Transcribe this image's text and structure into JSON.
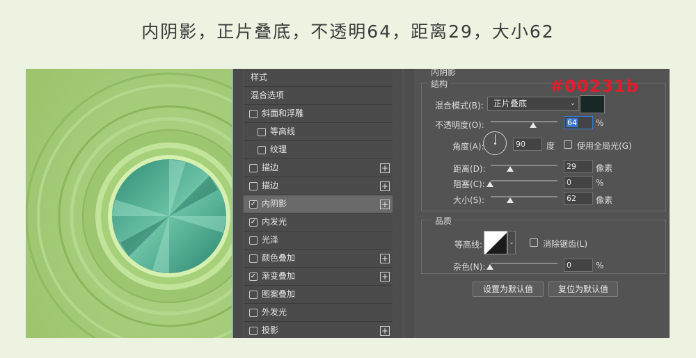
{
  "header": {
    "title": "内阴影，正片叠底，不透明64，距离29，大小62"
  },
  "annotation": {
    "hex_color": "#00231b",
    "color": "#e01e2a"
  },
  "style_list": {
    "items": [
      {
        "label": "样式",
        "checkbox": false,
        "checked": false,
        "plus": false,
        "active": false,
        "indent": 0
      },
      {
        "label": "混合选项",
        "checkbox": false,
        "checked": false,
        "plus": false,
        "active": false,
        "indent": 0
      },
      {
        "label": "斜面和浮雕",
        "checkbox": true,
        "checked": false,
        "plus": false,
        "active": false,
        "indent": 0
      },
      {
        "label": "等高线",
        "checkbox": true,
        "checked": false,
        "plus": false,
        "active": false,
        "indent": 1
      },
      {
        "label": "纹理",
        "checkbox": true,
        "checked": false,
        "plus": false,
        "active": false,
        "indent": 1
      },
      {
        "label": "描边",
        "checkbox": true,
        "checked": false,
        "plus": true,
        "active": false,
        "indent": 0
      },
      {
        "label": "描边",
        "checkbox": true,
        "checked": false,
        "plus": true,
        "active": false,
        "indent": 0
      },
      {
        "label": "内阴影",
        "checkbox": true,
        "checked": true,
        "plus": true,
        "active": true,
        "indent": 0
      },
      {
        "label": "内发光",
        "checkbox": true,
        "checked": true,
        "plus": false,
        "active": false,
        "indent": 0
      },
      {
        "label": "光泽",
        "checkbox": true,
        "checked": false,
        "plus": false,
        "active": false,
        "indent": 0
      },
      {
        "label": "颜色叠加",
        "checkbox": true,
        "checked": false,
        "plus": true,
        "active": false,
        "indent": 0
      },
      {
        "label": "渐变叠加",
        "checkbox": true,
        "checked": true,
        "plus": true,
        "active": false,
        "indent": 0
      },
      {
        "label": "图案叠加",
        "checkbox": true,
        "checked": false,
        "plus": false,
        "active": false,
        "indent": 0
      },
      {
        "label": "外发光",
        "checkbox": true,
        "checked": false,
        "plus": false,
        "active": false,
        "indent": 0
      },
      {
        "label": "投影",
        "checkbox": true,
        "checked": false,
        "plus": true,
        "active": false,
        "indent": 0
      }
    ]
  },
  "panel": {
    "section_title": "内阴影",
    "structure_title": "结构",
    "blend_mode_label": "混合模式(B):",
    "blend_mode_value": "正片叠底",
    "shadow_color": "#172826",
    "opacity_label": "不透明度(O):",
    "opacity_value": "64",
    "opacity_unit": "%",
    "opacity_level": 0.64,
    "angle_label": "角度(A):",
    "angle_value": "90",
    "angle_unit": "度",
    "global_light_label": "使用全局光(G)",
    "distance_label": "距离(D):",
    "distance_value": "29",
    "distance_unit": "像素",
    "choke_label": "阻塞(C):",
    "choke_value": "0",
    "choke_unit": "%",
    "size_label": "大小(S):",
    "size_value": "62",
    "size_unit": "像素",
    "quality_title": "品质",
    "contour_label": "等高线:",
    "antialias_label": "消除锯齿(L)",
    "noise_label": "杂色(N):",
    "noise_value": "0",
    "noise_unit": "%",
    "set_default_label": "设置为默认值",
    "reset_default_label": "复位为默认值"
  }
}
